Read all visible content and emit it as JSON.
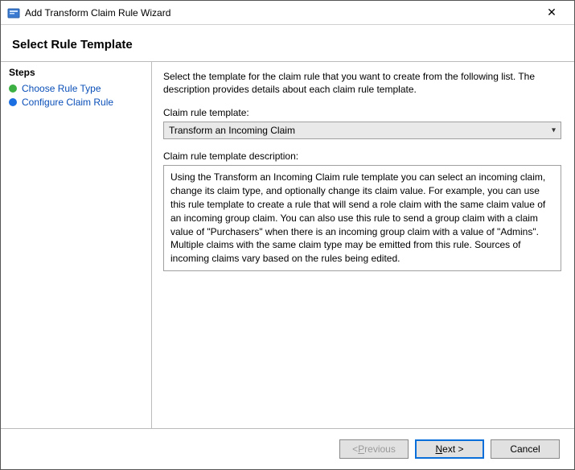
{
  "window": {
    "title": "Add Transform Claim Rule Wizard"
  },
  "header": {
    "title": "Select Rule Template"
  },
  "sidebar": {
    "heading": "Steps",
    "items": [
      {
        "label": "Choose Rule Type"
      },
      {
        "label": "Configure Claim Rule"
      }
    ]
  },
  "main": {
    "intro": "Select the template for the claim rule that you want to create from the following list. The description provides details about each claim rule template.",
    "template_label": "Claim rule template:",
    "template_value": "Transform an Incoming Claim",
    "desc_label": "Claim rule template description:",
    "desc_text": "Using the Transform an Incoming Claim rule template you can select an incoming claim, change its claim type, and optionally change its claim value.  For example, you can use this rule template to create a rule that will send a role claim with the same claim value of an incoming group claim.  You can also use this rule to send a group claim with a claim value of \"Purchasers\" when there is an incoming group claim with a value of \"Admins\".  Multiple claims with the same claim type may be emitted from this rule.  Sources of incoming claims vary based on the rules being edited."
  },
  "footer": {
    "previous_prefix": "< ",
    "previous_mnemonic": "P",
    "previous_rest": "revious",
    "next_mnemonic": "N",
    "next_rest": "ext >",
    "cancel": "Cancel"
  }
}
